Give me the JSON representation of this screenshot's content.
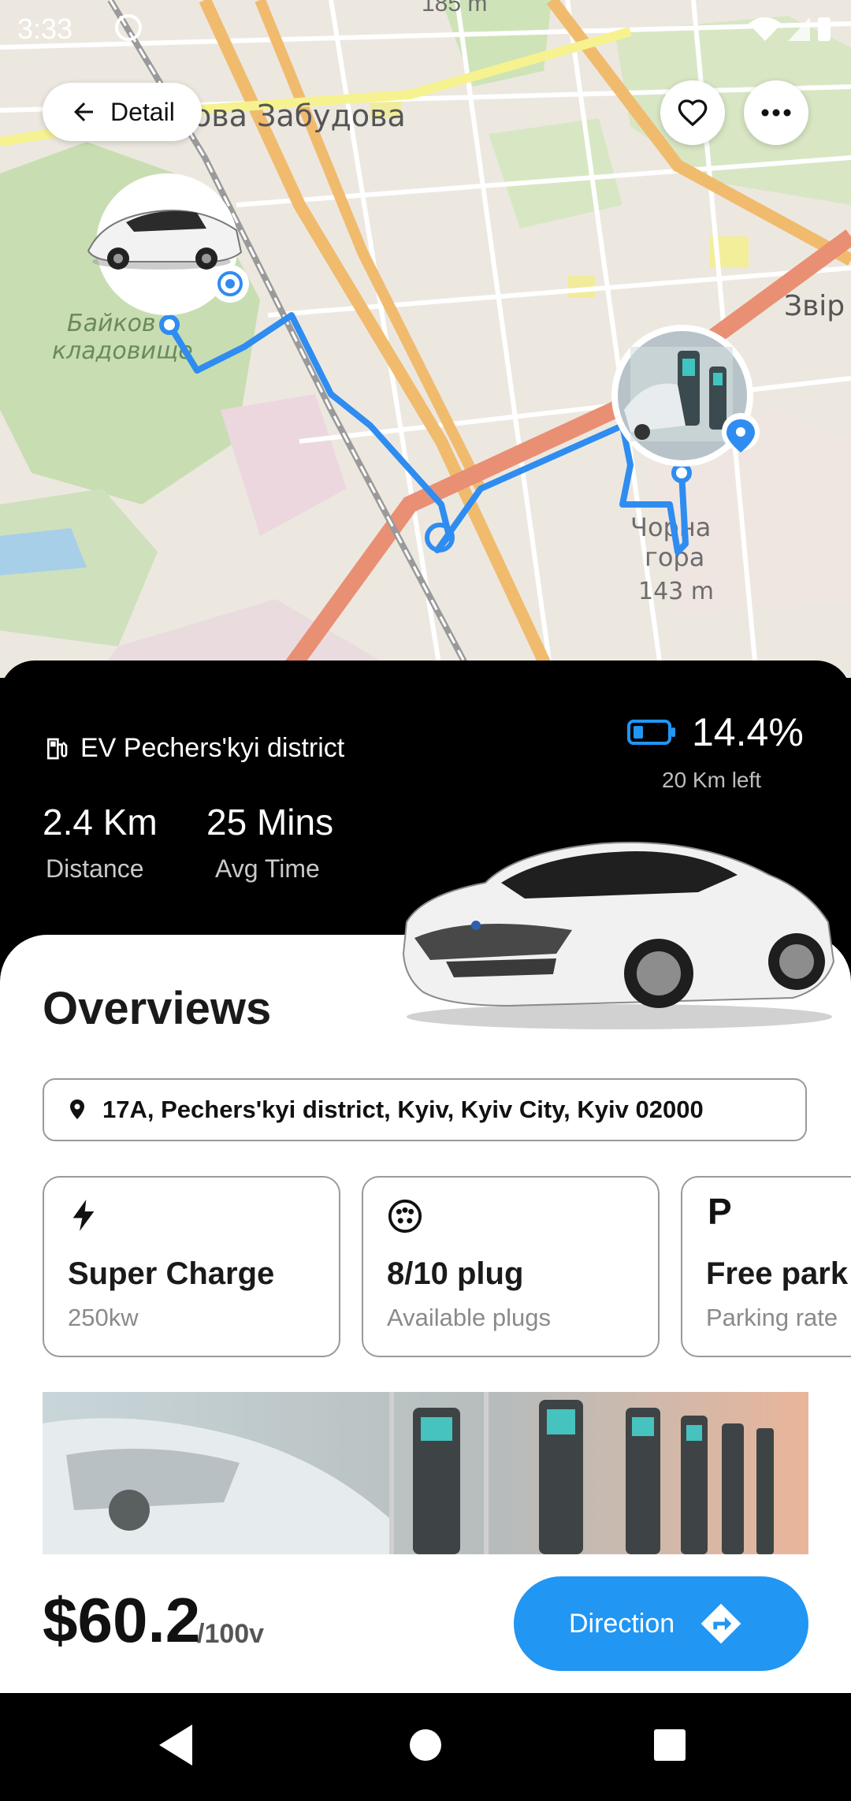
{
  "status_bar": {
    "time": "3:33"
  },
  "map": {
    "labels": [
      "185 m",
      "ова Забудова",
      "Байков",
      "кладовище",
      "Звір",
      "Чорна",
      "гора",
      "143 m"
    ],
    "route_color": "#2f8cf0"
  },
  "header": {
    "back_label": "Detail",
    "favorite_icon": "heart-outline-icon",
    "more_icon": "more-dots-icon"
  },
  "station": {
    "name": "EV Pechers'kyi district"
  },
  "stats": {
    "distance_value": "2.4 Km",
    "distance_label": "Distance",
    "time_value": "25 Mins",
    "time_label": "Avg Time"
  },
  "battery": {
    "percent": "14.4%",
    "remaining": "20 Km left",
    "level": 0.144
  },
  "overview": {
    "title": "Overviews",
    "address": "17A, Pechers'kyi district, Kyiv, Kyiv City, Kyiv 02000",
    "cards": [
      {
        "icon": "lightning-icon",
        "title": "Super Charge",
        "subtitle": "250kw"
      },
      {
        "icon": "plug-socket-icon",
        "title": "8/10 plug",
        "subtitle": "Available plugs"
      },
      {
        "icon": "parking-icon",
        "icon_text": "P",
        "title": "Free park",
        "subtitle": "Parking rate"
      }
    ]
  },
  "footer": {
    "price": "$60.2",
    "unit": "/100v",
    "direction_label": "Direction"
  },
  "colors": {
    "accent": "#2196f3",
    "dark": "#000000"
  }
}
